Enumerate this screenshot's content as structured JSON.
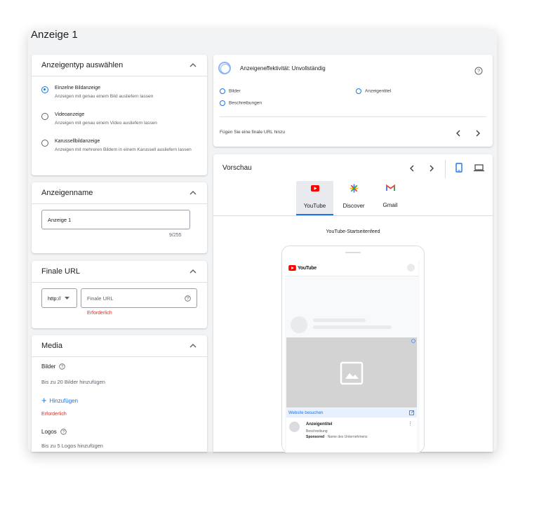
{
  "page_title": "Anzeige 1",
  "ad_type": {
    "title": "Anzeigentyp auswählen",
    "options": [
      {
        "label": "Einzelne Bildanzeige",
        "desc": "Anzeigen mit genau einem Bild ausliefern lassen",
        "selected": true
      },
      {
        "label": "Videoanzeige",
        "desc": "Anzeigen mit genau einem Video ausliefern lassen",
        "selected": false
      },
      {
        "label": "Karussellbildanzeige",
        "desc": "Anzeigen mit mehreren Bildern in einem Karussell ausliefern lassen",
        "selected": false
      }
    ]
  },
  "ad_name": {
    "title": "Anzeigenname",
    "value": "Anzeige 1",
    "counter": "9/255"
  },
  "final_url": {
    "title": "Finale URL",
    "protocol": "http://",
    "placeholder": "Finale URL",
    "error": "Erforderlich"
  },
  "media": {
    "title": "Media",
    "images_label": "Bilder",
    "images_hint": "Bis zu 20 Bilder hinzufügen",
    "add_label": "Hinzufügen",
    "error": "Erforderlich",
    "logos_label": "Logos",
    "logos_hint": "Bis zu 5 Logos hinzufügen"
  },
  "effectiveness": {
    "title": "Anzeigeneffektivität: Unvollständig",
    "items": [
      "Bilder",
      "Anzeigentitel",
      "Beschreibungen"
    ],
    "hint": "Fügen Sie eine finale URL hinzu"
  },
  "preview": {
    "title": "Vorschau",
    "tabs": [
      "YouTube",
      "Discover",
      "Gmail"
    ],
    "active_tab": "YouTube",
    "feed_label": "YouTube-Startseitenfeed",
    "yt_logo": "YouTube",
    "visit_label": "Website besuchen",
    "ad_title": "Anzeigentitel",
    "ad_desc": "Beschreibung",
    "sponsored": "Sponsored",
    "company": "· Name des Unternehmens"
  },
  "colors": {
    "accent": "#1a73e8",
    "error": "#d93025",
    "youtube_red": "#ff0000"
  }
}
